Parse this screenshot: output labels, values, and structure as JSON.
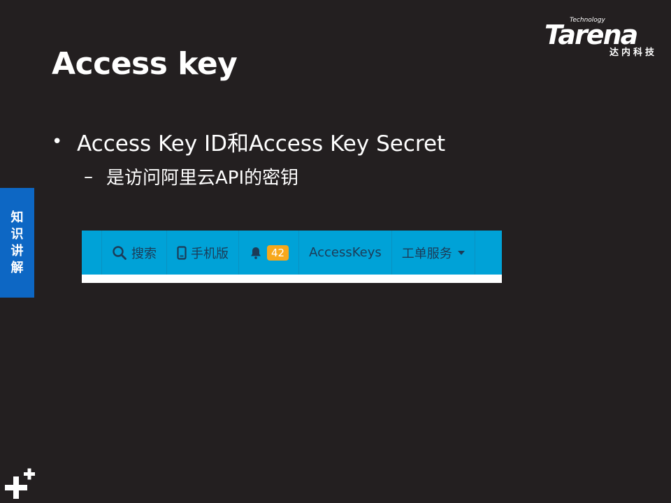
{
  "slide": {
    "title": "Access key",
    "bullets": [
      {
        "marker": "•",
        "text": "Access Key ID和Access Key Secret"
      },
      {
        "marker": "–",
        "text": "是访问阿里云API的密钥"
      }
    ],
    "side_tab": [
      "知",
      "识",
      "讲",
      "解"
    ]
  },
  "logo": {
    "tagline": "Technology",
    "brand": "Tarena",
    "sub": "达内科技"
  },
  "navbar": {
    "items": [
      {
        "label": "搜索",
        "icon": "search-icon"
      },
      {
        "label": "手机版",
        "icon": "mobile-icon"
      },
      {
        "label": "",
        "icon": "bell-icon",
        "badge": "42"
      },
      {
        "label": "AccessKeys"
      },
      {
        "label": "工单服务",
        "icon": "caret-down-icon"
      }
    ],
    "colors": {
      "bar": "#00a2d7",
      "text": "#1c3b57",
      "badge": "#f7a81b"
    }
  },
  "colors": {
    "background": "#231f20",
    "side_tab": "#0d67c4"
  }
}
